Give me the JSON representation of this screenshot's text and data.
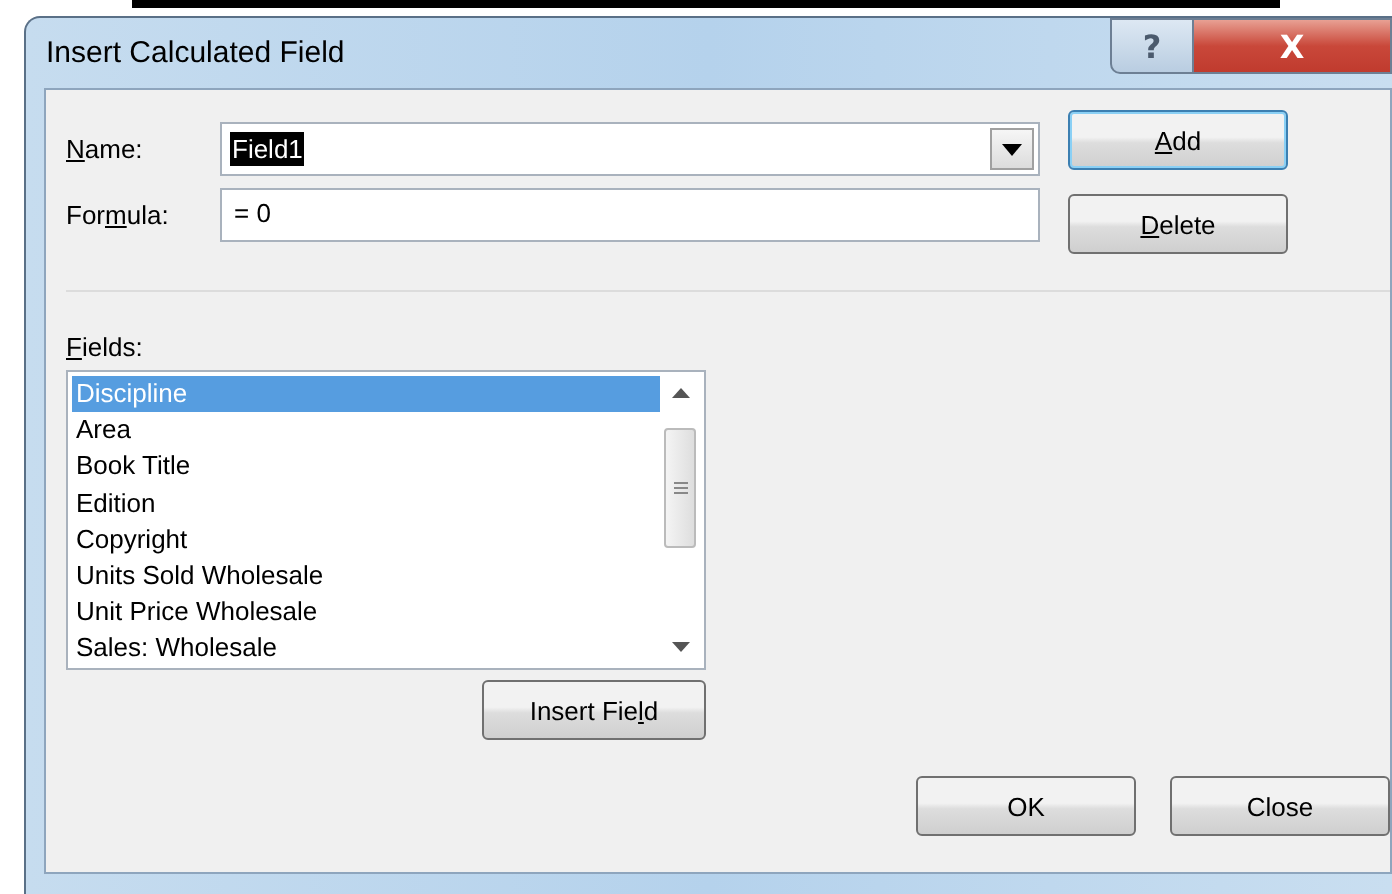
{
  "window": {
    "title": "Insert Calculated Field",
    "title_buttons": [
      {
        "kind": "help",
        "label": "?"
      },
      {
        "kind": "close",
        "label": "X"
      }
    ]
  },
  "name_field": {
    "label": {
      "key": "N",
      "post": "ame:"
    },
    "value": "Field1",
    "selected_text": true
  },
  "formula_field": {
    "label": {
      "pre": "For",
      "key": "m",
      "post": "ula:"
    },
    "value": "= 0"
  },
  "side_buttons": [
    {
      "label": {
        "key": "A",
        "post": "dd"
      },
      "default": true
    },
    {
      "label": {
        "key": "D",
        "post": "elete"
      },
      "default": false
    }
  ],
  "fields": {
    "label": {
      "key": "F",
      "post": "ields:"
    },
    "items": [
      {
        "text": "Discipline",
        "selected": true
      },
      {
        "text": "Area",
        "selected": false
      },
      {
        "text": "Book Title",
        "selected": false
      },
      {
        "text": "Edition",
        "selected": false
      },
      {
        "text": "Copyright",
        "selected": false
      },
      {
        "text": "Units Sold Wholesale",
        "selected": false
      },
      {
        "text": "Unit Price Wholesale",
        "selected": false
      },
      {
        "text": "Sales: Wholesale",
        "selected": false
      }
    ]
  },
  "insert_button": {
    "label": {
      "pre": "Insert Fie",
      "key": "l",
      "post": "d"
    }
  },
  "footer_buttons": [
    {
      "label": {
        "pre": "OK"
      }
    },
    {
      "label": {
        "pre": "Close"
      }
    }
  ]
}
